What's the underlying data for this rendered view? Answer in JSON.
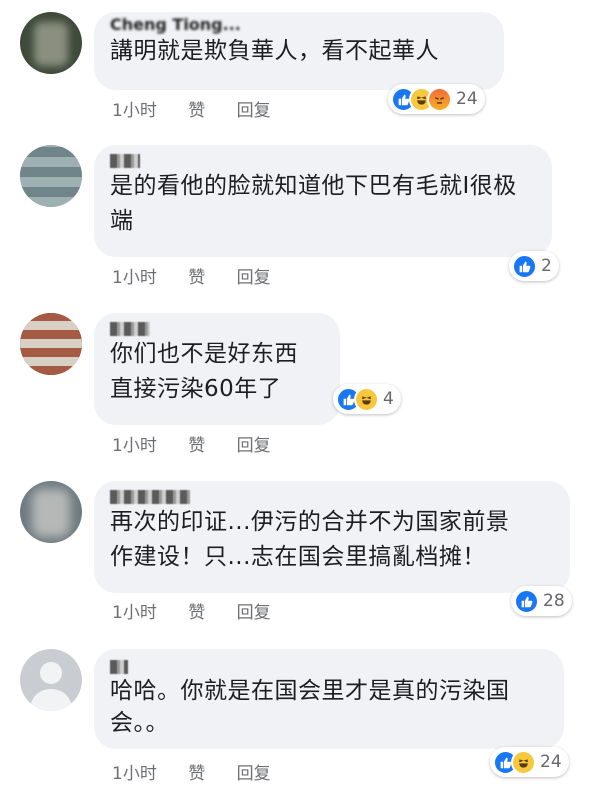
{
  "comments": [
    {
      "name": "Cheng Tiong...",
      "text": "講明就是欺負華人，看不起華人",
      "time": "1小时",
      "like_label": "赞",
      "reply_label": "回复",
      "reaction_icons": [
        "like-icon",
        "haha-icon",
        "angry-icon"
      ],
      "reaction_count": "24",
      "avatar_color": "#3f4a3a"
    },
    {
      "name": "",
      "text": "是的看他的脸就知道他下巴有毛就I很极端",
      "time": "1小时",
      "like_label": "赞",
      "reply_label": "回复",
      "reaction_icons": [
        "like-icon"
      ],
      "reaction_count": "2",
      "avatar_color": "#8fa1a3"
    },
    {
      "name": "",
      "text": "你们也不是好东西\n直接污染60年了",
      "time": "1小时",
      "like_label": "赞",
      "reply_label": "回复",
      "reaction_icons": [
        "like-icon",
        "haha-icon"
      ],
      "reaction_count": "4",
      "avatar_color": "#8b4b3c"
    },
    {
      "name": "",
      "text": "再次的印证...伊污的合并不为国家前景\n作建设！只...志在国会里搞亂档摊！",
      "time": "1小时",
      "like_label": "赞",
      "reply_label": "回复",
      "reaction_icons": [
        "like-icon"
      ],
      "reaction_count": "28",
      "avatar_color": "#6e7a80"
    },
    {
      "name": "",
      "text": "哈哈。你就是在国会里才是真的污染国\n会。。",
      "time": "1小时",
      "like_label": "赞",
      "reply_label": "回复",
      "reaction_icons": [
        "like-icon",
        "haha-icon"
      ],
      "reaction_count": "24",
      "avatar_color": "#c9cdd2"
    }
  ],
  "colors": {
    "bubble": "#f0f2f5",
    "meta_text": "#6d6f73",
    "like_blue": "#1877f2",
    "haha_yellow": "#f7c83d",
    "angry_orange": "#f36b3a"
  }
}
